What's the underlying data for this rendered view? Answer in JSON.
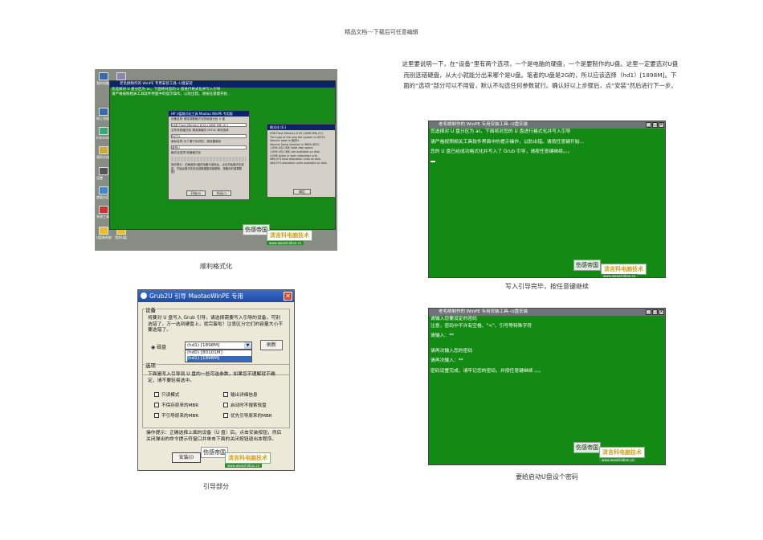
{
  "header": "精品文档---下载后可任意编辑",
  "paragraph": "这里要说明一下，在“设备”里有两个选项，一个是电脑的硬盘，一个是要制作的U盘。这里一定要选对U盘而别选错硬盘，从大小就能分出来哪个是U盘。笔者的U盘是2G的，所以应该选择（hd1）[1898M]。下面的“选项”部分可以不用管，默认不勾选任何参数就行。确认好以上步骤后，点“安装”然后进行下一步。",
  "captions": {
    "desktop": "顺利格式化",
    "grub": "引导部分",
    "console1": "写入引导完毕，按任意键继续",
    "console2": "要给启动U盘设个密码"
  },
  "desktop": {
    "icons": [
      "我的电脑",
      "回收站",
      "网上邻居",
      "Internet",
      "我的文档",
      "设置",
      "超级分区",
      "激活",
      "系统工具",
      "Ghost32",
      "U盘装系统",
      "我的U盘"
    ],
    "console_title": "老毛桃制作的 WinPE 专用安装工具--U盘安装",
    "console_lines": [
      "您选择对 U 盘分区为 ar。下面将对您的 U 盘进行格式化并写入引导",
      "请严格按照相关工具软件界面中的提示操作，以防出错。请按任意键开始..."
    ],
    "format_dialog": {
      "title": "HP U盘格式化工具 Maotao WinPE 专用版",
      "device_label": "设备名称 请选择要格式化的磁盘分区 U 盘",
      "device_value": "USB Flash Memory 6.00 (1898 MB) (E:)",
      "fs_label": "文件系统格式化 请选择格式 FAT32 请勿选择",
      "fs_value": "FAT32",
      "volume_label": "卷标名称 为了便于你识别，请设置卷标",
      "volume_value": "我的U",
      "options_label": "格式化选项 快速格式化",
      "note": "操作提示：正确选择U盘的设备与卷标后，点击开始格式化按钮，开始后格式化的全部数据都将被删除，请备份好重要数据！",
      "start_button": "开始(S)",
      "close_button": "关闭(C)"
    },
    "info_dialog": {
      "title": "格式化 (E:)",
      "lines": [
        "USB Flash Memory 6.00 (1898 MB) (E:)",
        "The type of the new file system is FAT32.",
        "Volume label is 我的U.",
        "Volume Serial Number is 9B6A-4E5C.",
        "1,894,432 (KB) total disk space.",
        "1,894,432 (KB) are available on disk.",
        "4,096 bytes in each allocation unit.",
        "466,973 total allocation units on disk.",
        "466,973 allocation units available on disk."
      ],
      "ok_button": "确定"
    }
  },
  "grub": {
    "title": "Grub2U 引导 MaotaoWinPE 专用",
    "device_group": "设备",
    "device_text": "将要对 U 盘写入 Grub 引导，请选择需要写入引导的设备，可别选错了，万一选到硬盘上，就完蛋啦！注意区分它们的容量大小不要选错了。",
    "radio_label": "磁盘",
    "select_value": "(hd1) [1898M]",
    "options": [
      "(hd0) [80101M]",
      "(hd1) [1898M]"
    ],
    "refresh_button": "刷新",
    "options_group": "选项",
    "options_text": "下面是写入引导到 U 盘的一些可选参数，如果您不理解就不确定，请不要轻易选中。",
    "checkboxes": [
      "只读模式",
      "不保存原来的MBR",
      "不引导原来的MBR",
      "输出详细信息",
      "启动时不搜索软盘",
      "优先引导原来的MBR"
    ],
    "hint": "操作提示：正确选择上面的设备（U 盘）后，点击安装按钮，然后关闭弹出的命令提示符窗口并单击下面的关闭按钮退出本程序。",
    "install_button": "安装(I)"
  },
  "console1": {
    "title": "老毛桃制作的 WinPE 专用安装工具--U盘安装",
    "lines": [
      "您选择对 U 盘分区为 ar。下面将对您的 U 盘进行格式化并写入引导",
      "请严格按照相关工具软件界面中的提示操作，以防出错。请按任意键开始...",
      "您的 U 盘已经成功格式化并写入了 Grub 引导，请按任意键继续。。。"
    ]
  },
  "console2": {
    "title": "老毛桃制作的 WinPE 专用安装工具--U盘安装",
    "lines": [
      "请输入您要设定的密码",
      "注意，密码中不许有空格、\"<\"、引号等特殊字符",
      "请输入：**",
      "请再次输入您的密码",
      "请再次输入：**",
      "密码设置完成，请牢记您的密码，并按任意键继续 。。。"
    ]
  },
  "watermark": {
    "left": "伤感帝国",
    "brand": "清言科电脑技术",
    "url": "www.woaishidian.cn"
  },
  "colors": {
    "console_green": "#138a14",
    "title_blue": "#0a246a"
  }
}
